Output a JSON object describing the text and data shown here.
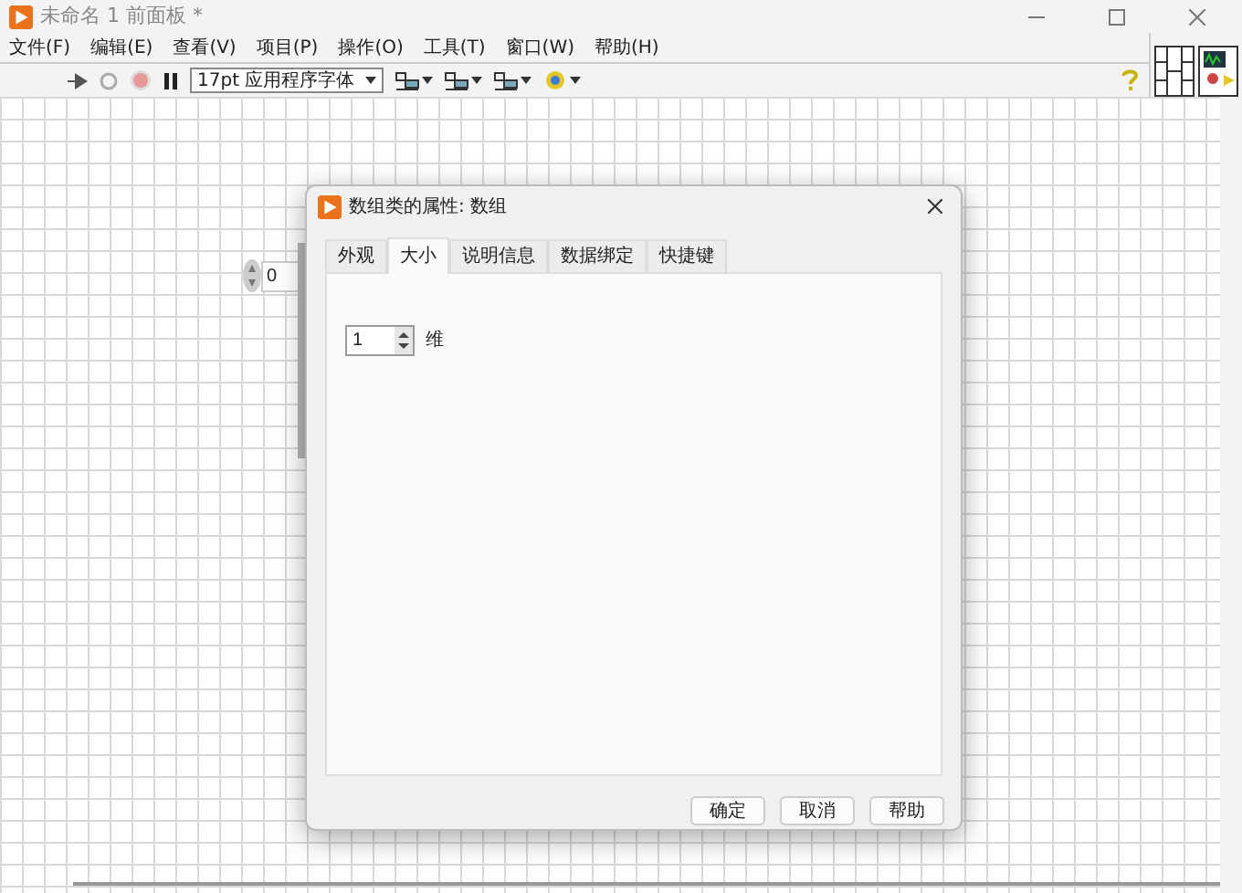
{
  "window": {
    "title": "未命名 1 前面板 *"
  },
  "menu": [
    "文件(F)",
    "编辑(E)",
    "查看(V)",
    "项目(P)",
    "操作(O)",
    "工具(T)",
    "窗口(W)",
    "帮助(H)"
  ],
  "toolbar": {
    "font": "17pt 应用程序字体"
  },
  "canvas": {
    "numeric": {
      "value": "0"
    }
  },
  "dialog": {
    "title": "数组类的属性: 数组",
    "tabs": [
      {
        "label": "外观",
        "selected": false
      },
      {
        "label": "大小",
        "selected": true
      },
      {
        "label": "说明信息",
        "selected": false
      },
      {
        "label": "数据绑定",
        "selected": false
      },
      {
        "label": "快捷键",
        "selected": false
      }
    ],
    "dimensions": {
      "value": "1",
      "label": "维"
    },
    "buttons": [
      "确定",
      "取消",
      "帮助"
    ]
  }
}
